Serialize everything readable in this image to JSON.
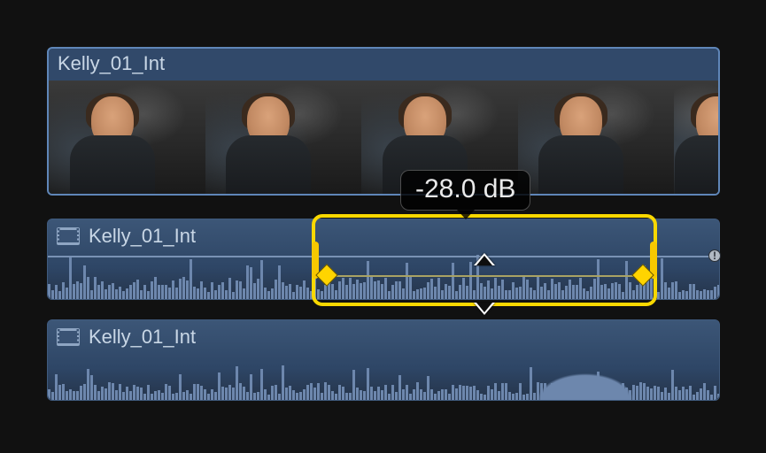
{
  "video_clip": {
    "title": "Kelly_01_Int",
    "thumbnail_count": 5
  },
  "audio_clip_1": {
    "title": "Kelly_01_Int",
    "volume_label": "-28.0 dB",
    "volume_db": -28.0,
    "range": {
      "start_pct": 40,
      "end_pct": 90
    },
    "keyframes": [
      {
        "pos_pct": 41.5,
        "level_pct": 72
      },
      {
        "pos_pct": 88.5,
        "level_pct": 72
      }
    ],
    "baseline_level_pct": 46
  },
  "audio_clip_2": {
    "title": "Kelly_01_Int"
  },
  "colors": {
    "clip_bg": "#2e4666",
    "waveform": "#6d87ad",
    "selection": "#f9d800",
    "keyframe": "#ffd400"
  }
}
